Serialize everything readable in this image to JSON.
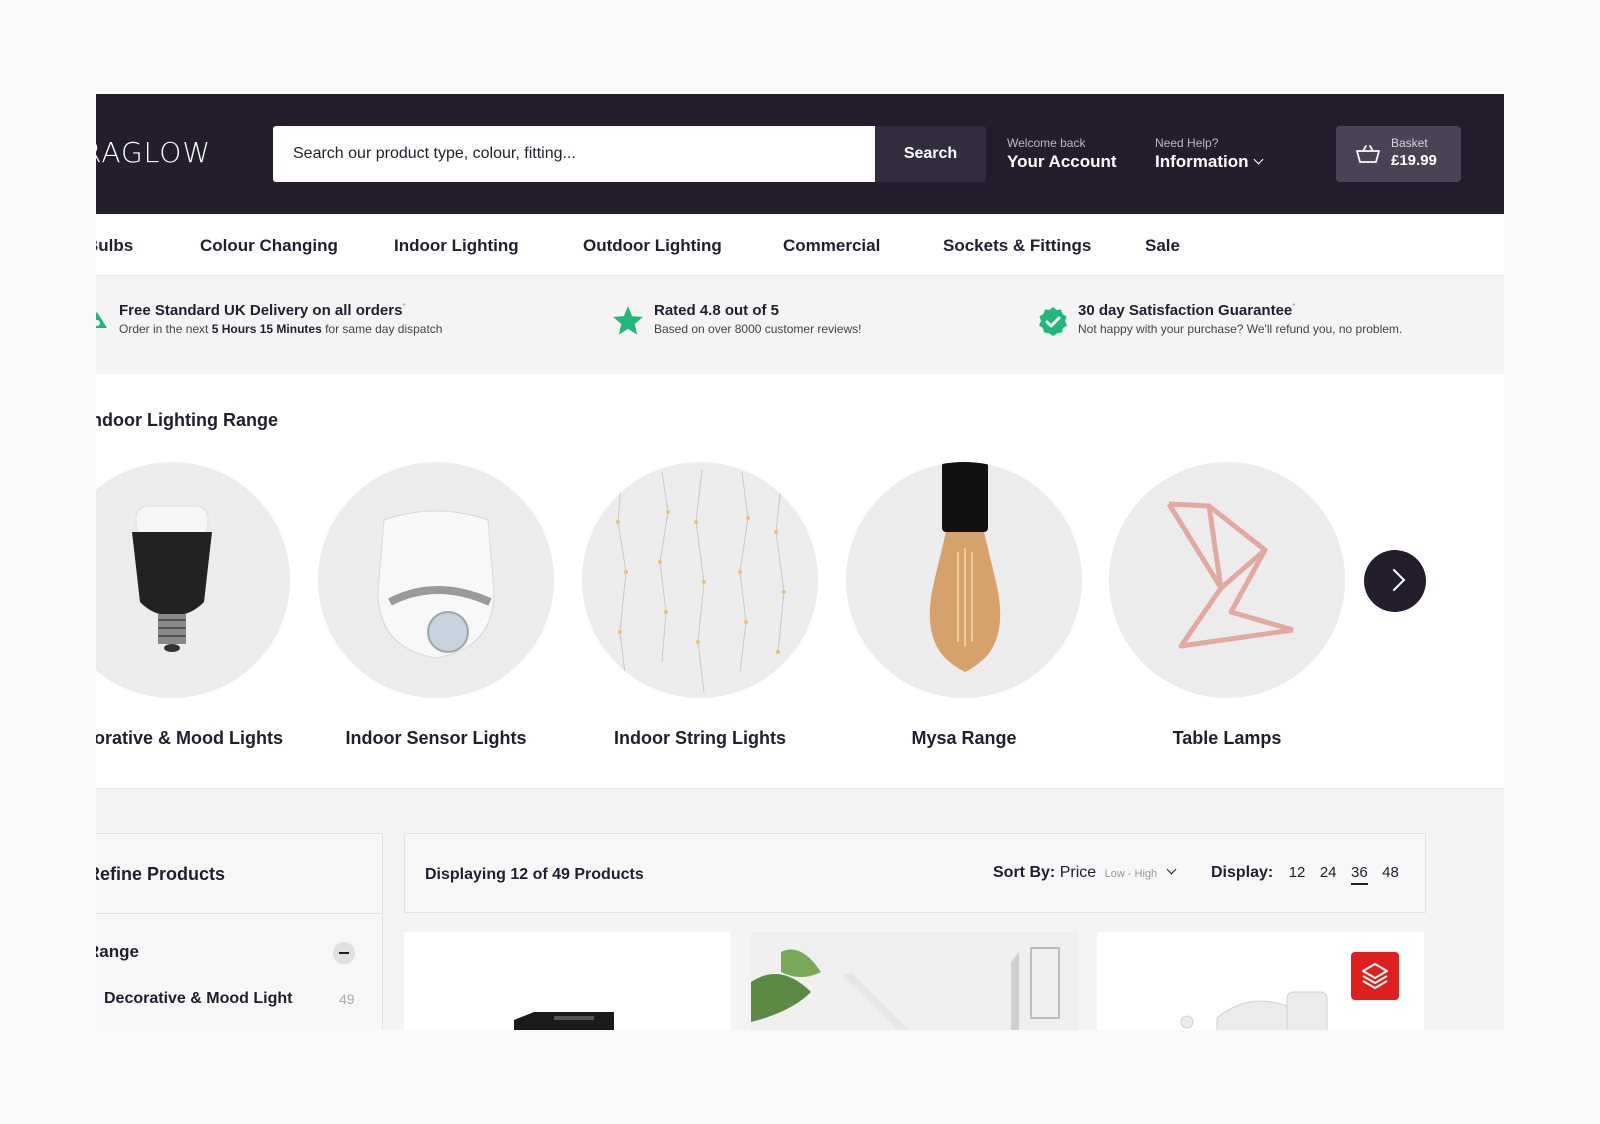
{
  "header": {
    "logo": "RAGLOW",
    "search_placeholder": "Search our product type, colour, fitting...",
    "search_button": "Search",
    "account": {
      "small": "Welcome back",
      "big": "Your Account"
    },
    "help": {
      "small": "Need Help?",
      "big": "Information"
    },
    "basket": {
      "small": "Basket",
      "amount": "£19.99"
    }
  },
  "nav": [
    "Bulbs",
    "Colour Changing",
    "Indoor Lighting",
    "Outdoor Lighting",
    "Commercial",
    "Sockets & Fittings",
    "Sale"
  ],
  "benefits": [
    {
      "icon": "delivery-icon",
      "title": "Free Standard UK Delivery on all orders",
      "sub_pre": "Order in the next ",
      "sub_bold": "5 Hours 15 Minutes",
      "sub_post": " for same day dispatch"
    },
    {
      "icon": "star-icon",
      "title": "Rated 4.8 out of 5",
      "sub": "Based on over 8000 customer reviews!"
    },
    {
      "icon": "check-badge-icon",
      "title": "30 day Satisfaction Guarantee",
      "sub": "Not happy with your purchase? We'll refund you, no problem."
    }
  ],
  "range": {
    "title": "Indoor Lighting Range",
    "categories": [
      {
        "label": "Decorative & Mood Lights",
        "icon": "smart-bulb-image"
      },
      {
        "label": "Indoor Sensor Lights",
        "icon": "sensor-light-image"
      },
      {
        "label": "Indoor String Lights",
        "icon": "string-lights-image"
      },
      {
        "label": "Mysa Range",
        "icon": "filament-bulb-image"
      },
      {
        "label": "Table Lamps",
        "icon": "table-lamp-image"
      }
    ]
  },
  "refine": {
    "title": "Refine Products",
    "section": "Range",
    "items": [
      {
        "label": "Decorative & Mood Light",
        "count": "49"
      }
    ]
  },
  "toolbar": {
    "displaying": "Displaying 12 of 49 Products",
    "sort_label": "Sort By:",
    "sort_value": "Price",
    "sort_range": "Low - High",
    "display_label": "Display:",
    "display_options": [
      "12",
      "24",
      "36",
      "48"
    ],
    "display_active": "36"
  },
  "colors": {
    "brand": "#231d2e",
    "accent_green": "#1db87a",
    "badge_red": "#e0201f"
  }
}
